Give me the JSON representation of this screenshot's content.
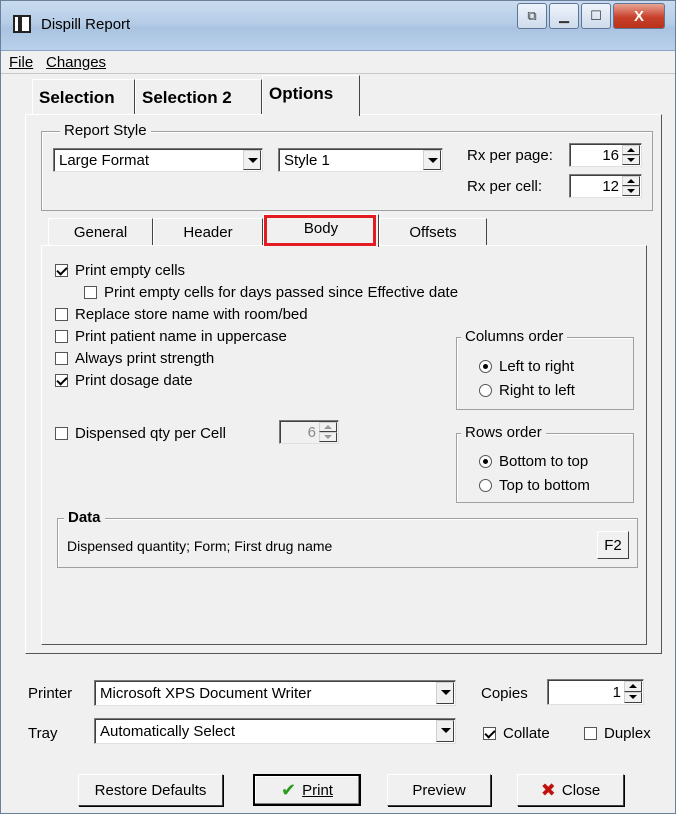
{
  "window": {
    "title": "Dispill Report",
    "controls": {
      "restore": "⧉",
      "minimize": "▁",
      "maximize": "☐",
      "close": "X"
    }
  },
  "menu": {
    "file_label": "File",
    "changes_label": "Changes"
  },
  "main_tabs": [
    {
      "label": "Selection"
    },
    {
      "label": "Selection 2"
    },
    {
      "label": "Options",
      "active": true
    }
  ],
  "report_style": {
    "group_label": "Report Style",
    "format_value": "Large Format",
    "style_value": "Style 1",
    "rx_per_page_label": "Rx per page:",
    "rx_per_page_value": "16",
    "rx_per_cell_label": "Rx per cell:",
    "rx_per_cell_value": "12"
  },
  "sub_tabs": [
    {
      "label": "General"
    },
    {
      "label": "Header"
    },
    {
      "label": "Body",
      "active": true
    },
    {
      "label": "Offsets"
    }
  ],
  "body": {
    "print_empty_cells": {
      "label": "Print empty cells",
      "checked": true
    },
    "print_empty_days": {
      "label": "Print empty cells for days passed since Effective date",
      "checked": false
    },
    "replace_store": {
      "label": "Replace store name with room/bed",
      "checked": false
    },
    "patient_uppercase": {
      "label": "Print patient name in uppercase",
      "checked": false
    },
    "always_strength": {
      "label": "Always print strength",
      "checked": false
    },
    "dosage_date": {
      "label": "Print dosage date",
      "checked": true
    },
    "dispensed_qty": {
      "label": "Dispensed qty per Cell",
      "checked": false,
      "value": "6"
    },
    "columns_order": {
      "label": "Columns order",
      "left_to_right": "Left to right",
      "right_to_left": "Right to left",
      "selected": "left_to_right"
    },
    "rows_order": {
      "label": "Rows order",
      "bottom_to_top": "Bottom to top",
      "top_to_bottom": "Top to bottom",
      "selected": "bottom_to_top"
    },
    "data": {
      "label": "Data",
      "value": "Dispensed quantity; Form; First drug name",
      "button": "F2"
    }
  },
  "printer": {
    "label": "Printer",
    "value": "Microsoft XPS Document Writer",
    "copies_label": "Copies",
    "copies_value": "1"
  },
  "tray": {
    "label": "Tray",
    "value": "Automatically Select",
    "collate_label": "Collate",
    "collate_checked": true,
    "duplex_label": "Duplex",
    "duplex_checked": false
  },
  "buttons": {
    "restore_defaults": "Restore Defaults",
    "print": "Print",
    "preview": "Preview",
    "close": "Close"
  },
  "colors": {
    "highlight": "#e31b23",
    "check": "#2a9a1c",
    "close_x": "#c0120c"
  }
}
